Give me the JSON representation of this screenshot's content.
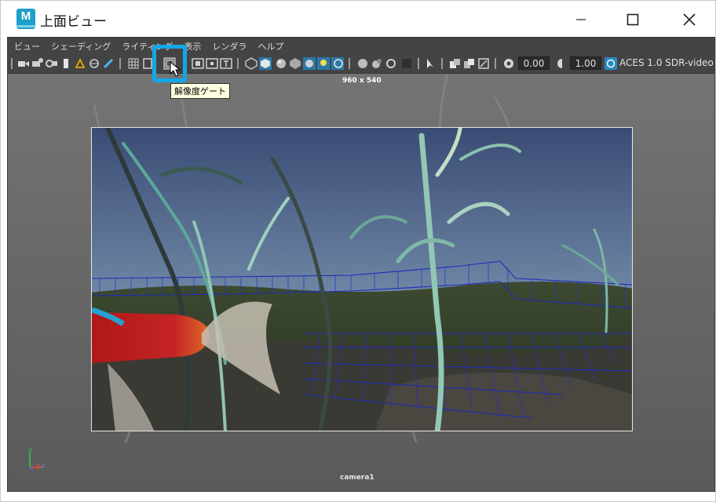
{
  "window": {
    "title": "上面ビュー",
    "icon": "maya-app-icon"
  },
  "menubar": {
    "items": [
      "ビュー",
      "シェーディング",
      "ライティング",
      "表示",
      "レンダラ",
      "ヘルプ"
    ]
  },
  "toolbar": {
    "exposure_value": "0.00",
    "gamma_value": "1.00",
    "color_space": "ACES 1.0 SDR-video",
    "highlighted_icon": "resolution-gate-icon",
    "accent_color": "#11a8e8"
  },
  "tooltip": {
    "text": "解像度ゲート"
  },
  "viewport": {
    "resolution_label": "960 x 540",
    "camera_label": "camera1",
    "axis_labels": {
      "y": "y",
      "x": "x",
      "z": "z"
    }
  }
}
